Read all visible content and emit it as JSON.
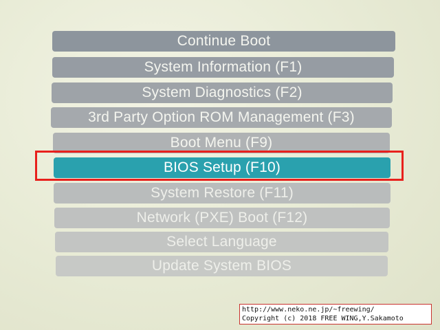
{
  "menu": {
    "items": [
      {
        "label": "Continue Boot"
      },
      {
        "label": "System Information (F1)"
      },
      {
        "label": "System Diagnostics (F2)"
      },
      {
        "label": "3rd Party Option ROM Management (F3)"
      },
      {
        "label": "Boot Menu (F9)"
      },
      {
        "label": "BIOS Setup (F10)",
        "selected": true
      },
      {
        "label": "System Restore (F11)"
      },
      {
        "label": "Network (PXE) Boot (F12)"
      },
      {
        "label": "Select Language"
      },
      {
        "label": "Update System BIOS"
      }
    ]
  },
  "highlight": {
    "target": "BIOS Setup (F10)",
    "color": "#e8201c"
  },
  "colors": {
    "selected_item": "#2aa1ae",
    "item_default": "#969ca3",
    "background": "#eef0df"
  },
  "watermark": {
    "line1": "http://www.neko.ne.jp/~freewing/",
    "line2": "Copyright (c) 2018 FREE WING,Y.Sakamoto"
  }
}
